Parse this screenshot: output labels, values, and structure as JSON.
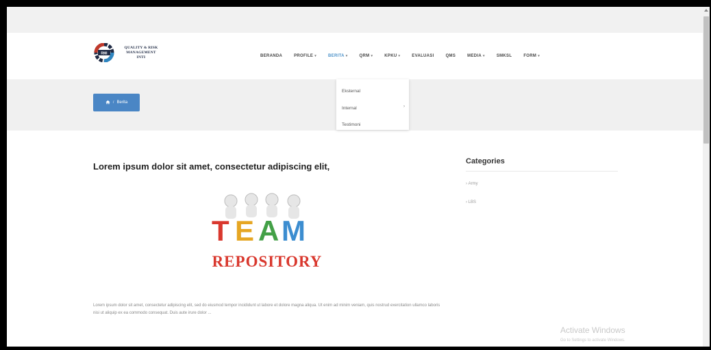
{
  "logo": {
    "line1": "QUALITY & RISK",
    "line2": "MANAGEMENT",
    "line3": "INTI",
    "badge": "RMI"
  },
  "nav": {
    "items": [
      {
        "label": "BERANDA",
        "dropdown": false,
        "active": false
      },
      {
        "label": "PROFILE",
        "dropdown": true,
        "active": false
      },
      {
        "label": "BERITA",
        "dropdown": true,
        "active": true
      },
      {
        "label": "QRM",
        "dropdown": true,
        "active": false
      },
      {
        "label": "KPKU",
        "dropdown": true,
        "active": false
      },
      {
        "label": "EVALUASI",
        "dropdown": false,
        "active": false
      },
      {
        "label": "QMS",
        "dropdown": false,
        "active": false
      },
      {
        "label": "MEDIA",
        "dropdown": true,
        "active": false
      },
      {
        "label": "SMKSL",
        "dropdown": false,
        "active": false
      },
      {
        "label": "FORM",
        "dropdown": true,
        "active": false
      }
    ]
  },
  "dropdown": {
    "items": [
      "Eksternal",
      "Internal",
      "Testimoni"
    ]
  },
  "breadcrumb": {
    "label": "Berita"
  },
  "post": {
    "title": "Lorem ipsum dolor sit amet, consectetur adipiscing elit,",
    "image_caption": "REPOSITORY",
    "image_word": "TEAM",
    "excerpt": "Lorem ipsum dolor sit amet, consectetur adipiscing elit, sed do eiusmod tempor incididunt ut labore et dolore magna aliqua. Ut enim ad minim veniam, quis nostrud exercitation ullamco laboris nisi ut aliquip ex ea commodo consequat. Duis aute irure dolor ..."
  },
  "sidebar": {
    "title": "Categories",
    "categories": [
      "Army",
      "LBS"
    ]
  },
  "watermark": {
    "line1": "Activate Windows",
    "line2": "Go to Settings to activate Windows."
  },
  "colors": {
    "accent": "#4a86c5",
    "nav_active": "#4a90c8"
  }
}
